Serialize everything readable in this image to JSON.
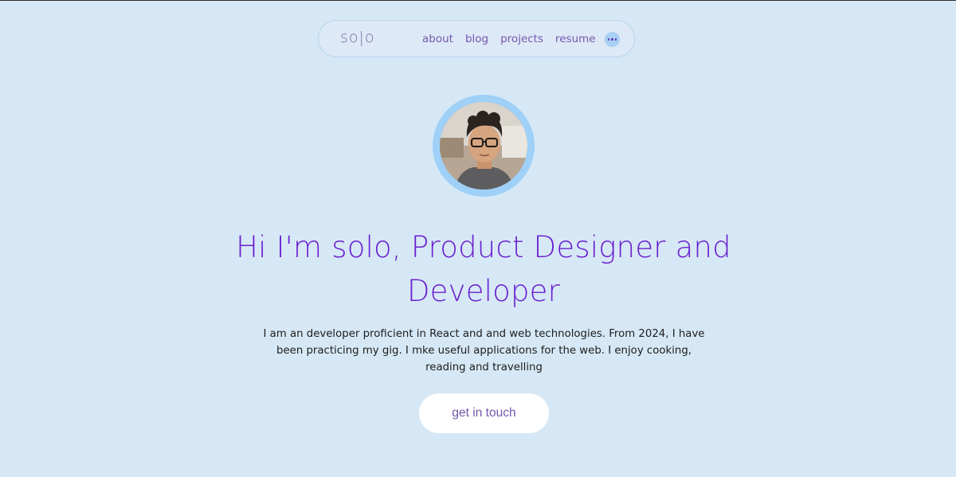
{
  "nav": {
    "logo": "so|o",
    "links": [
      "about",
      "blog",
      "projects",
      "resume"
    ],
    "more_icon": "ellipsis-icon"
  },
  "profile": {
    "avatar": "profile-photo"
  },
  "hero": {
    "headline": "Hi I'm solo, Product Designer and Developer",
    "bio": "I am an developer proficient in React and and web technologies. From 2024, I have been practicing my gig. I mke useful applications for the web. I enjoy cooking, reading and travelling",
    "cta_label": "get in touch"
  },
  "colors": {
    "background": "#d6e8f5",
    "accent": "#6a1fd0",
    "nav_text": "#7457ae",
    "avatar_ring": "#9fd0f7"
  }
}
